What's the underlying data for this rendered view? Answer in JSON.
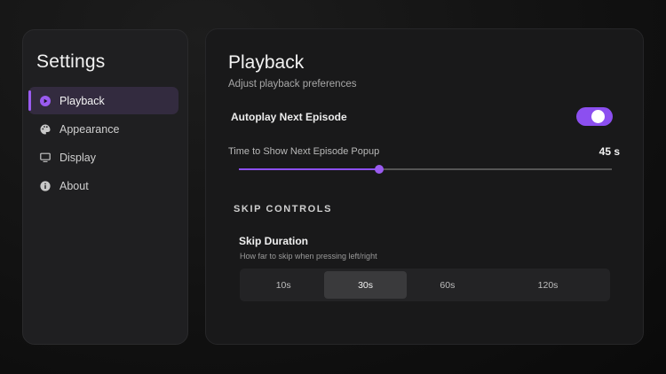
{
  "sidebar": {
    "title": "Settings",
    "items": [
      {
        "label": "Playback",
        "icon": "play-circle-icon",
        "active": true
      },
      {
        "label": "Appearance",
        "icon": "palette-icon",
        "active": false
      },
      {
        "label": "Display",
        "icon": "monitor-icon",
        "active": false
      },
      {
        "label": "About",
        "icon": "info-icon",
        "active": false
      }
    ]
  },
  "main": {
    "title": "Playback",
    "subtitle": "Adjust playback preferences",
    "autoplay": {
      "label": "Autoplay Next Episode",
      "enabled": true
    },
    "popup": {
      "label": "Time to Show Next Episode Popup",
      "value_text": "45 s",
      "fraction": 0.375
    },
    "section_title": "SKIP CONTROLS",
    "skip": {
      "title": "Skip Duration",
      "description": "How far to skip when pressing left/right",
      "options": [
        "10s",
        "30s",
        "60s",
        "120s"
      ],
      "selected": "30s"
    }
  },
  "colors": {
    "accent": "#8c4ff0",
    "active_bg": "#332b3f",
    "panel": "#19191a"
  }
}
